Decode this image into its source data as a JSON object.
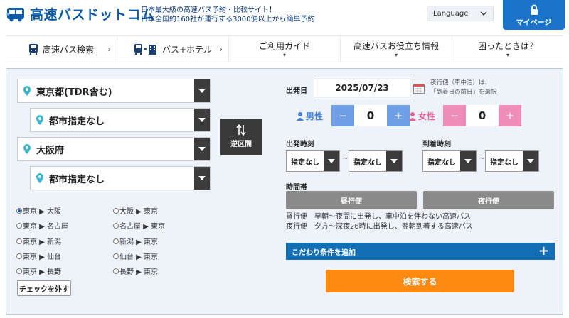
{
  "header": {
    "logo_text": "高速バスドットコム",
    "tagline_line1": "日本最大級の高速バス予約・比較サイト！",
    "tagline_line2": "日本全国約160社が運行する3000便以上から簡単予約",
    "language_label": "Language",
    "mypage_label": "マイページ"
  },
  "nav": {
    "items": [
      {
        "label": "高速バス検索",
        "icon": "bus-icon"
      },
      {
        "label": "バス+ホテル",
        "icon": "bus-hotel-icon"
      },
      {
        "label": "ご利用ガイド"
      },
      {
        "label": "高速バスお役立ち情報"
      },
      {
        "label": "困ったときは？"
      }
    ]
  },
  "search": {
    "from_pref": "東京都(TDR含む)",
    "from_city": "都市指定なし",
    "to_pref": "大阪府",
    "to_city": "都市指定なし",
    "swap_label": "逆区間",
    "routes": [
      {
        "label": "東京 ▶ 大阪",
        "checked": true
      },
      {
        "label": "大阪 ▶ 東京",
        "checked": false
      },
      {
        "label": "東京 ▶ 名古屋",
        "checked": false
      },
      {
        "label": "名古屋 ▶ 東京",
        "checked": false
      },
      {
        "label": "東京 ▶ 新潟",
        "checked": false
      },
      {
        "label": "新潟 ▶ 東京",
        "checked": false
      },
      {
        "label": "東京 ▶ 仙台",
        "checked": false
      },
      {
        "label": "仙台 ▶ 東京",
        "checked": false
      },
      {
        "label": "東京 ▶ 長野",
        "checked": false
      },
      {
        "label": "長野 ▶ 東京",
        "checked": false
      }
    ],
    "uncheck_label": "チェックを外す",
    "date_label": "出発日",
    "date_value": "2025/07/23",
    "night_note_line1": "夜行便（車中泊）は、",
    "night_note_line2": "「到着日の前日」を選択",
    "male_label": "男性",
    "male_count": "0",
    "female_label": "女性",
    "female_count": "0",
    "minus": "−",
    "plus": "+",
    "depart_time_label": "出発時刻",
    "arrive_time_label": "到着時刻",
    "time_any": "指定なし",
    "tilde": "~",
    "band_label": "時間帯",
    "day_bus": "昼行便",
    "night_bus": "夜行便",
    "desc_line1": "昼行便　早朝～夜間に出発し、車中泊を伴わない高速バス",
    "desc_line2": "夜行便　夕方～深夜26時に出発し、翌朝到着する高速バス",
    "add_condition": "こだわり条件を追加",
    "add_plus": "+",
    "search_button": "検索する"
  },
  "colors": {
    "brand_blue": "#0a5aa8",
    "mypage_blue": "#1a73c8",
    "male_blue": "#6f9fe6",
    "female_pink": "#f08cb8",
    "search_orange": "#ff8a12",
    "cond_blue": "#146eb4"
  }
}
